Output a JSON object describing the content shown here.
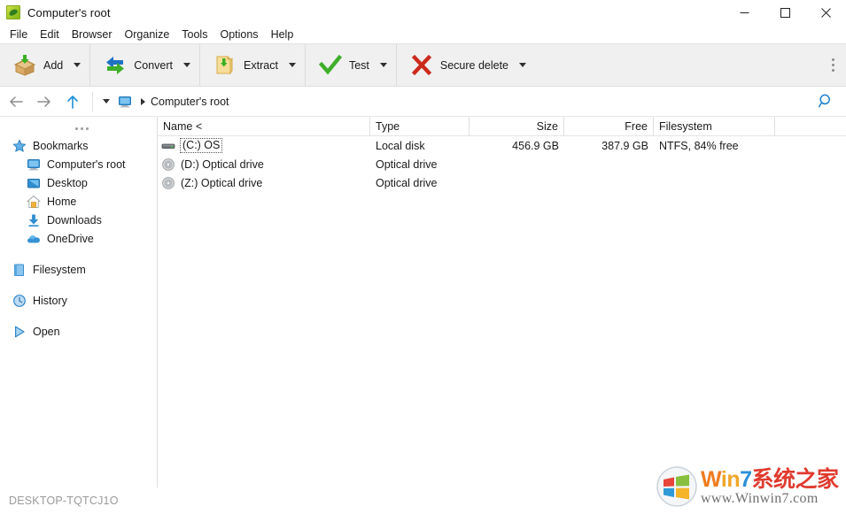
{
  "window": {
    "title": "Computer's root",
    "app_icon": "peazip-icon",
    "controls": {
      "minimize": "minimize-icon",
      "maximize": "maximize-icon",
      "close": "close-icon"
    }
  },
  "menubar": {
    "items": [
      {
        "label": "File"
      },
      {
        "label": "Edit"
      },
      {
        "label": "Browser"
      },
      {
        "label": "Organize"
      },
      {
        "label": "Tools"
      },
      {
        "label": "Options"
      },
      {
        "label": "Help"
      }
    ]
  },
  "toolbar": {
    "buttons": [
      {
        "label": "Add",
        "icon": "add-box-icon",
        "has_dropdown": true
      },
      {
        "label": "Convert",
        "icon": "convert-arrows-icon",
        "has_dropdown": true
      },
      {
        "label": "Extract",
        "icon": "extract-folder-icon",
        "has_dropdown": true
      },
      {
        "label": "Test",
        "icon": "check-mark-icon",
        "has_dropdown": true
      },
      {
        "label": "Secure delete",
        "icon": "red-x-icon",
        "has_dropdown": true
      }
    ],
    "overflow": "toolbar-overflow-icon"
  },
  "addressbar": {
    "back": "back-arrow-icon",
    "forward": "forward-arrow-icon",
    "up": "up-arrow-icon",
    "history_caret": "chevron-down-icon",
    "computer_icon": "computer-monitor-icon",
    "path": "Computer's root",
    "search": "search-icon"
  },
  "sidebar": {
    "overflow": "sidebar-overflow-dots",
    "items": [
      {
        "label": "Bookmarks",
        "icon": "star-icon",
        "indent": false
      },
      {
        "label": "Computer's root",
        "icon": "computer-monitor-icon",
        "indent": true
      },
      {
        "label": "Desktop",
        "icon": "desktop-icon",
        "indent": true
      },
      {
        "label": "Home",
        "icon": "home-icon",
        "indent": true
      },
      {
        "label": "Downloads",
        "icon": "download-arrow-icon",
        "indent": true
      },
      {
        "label": "OneDrive",
        "icon": "cloud-icon",
        "indent": true
      },
      {
        "label": "Filesystem",
        "icon": "filesystem-book-icon",
        "indent": false,
        "gap": true
      },
      {
        "label": "History",
        "icon": "clock-icon",
        "indent": false,
        "gap": true
      },
      {
        "label": "Open",
        "icon": "play-triangle-icon",
        "indent": false,
        "gap": true
      }
    ]
  },
  "filelist": {
    "columns": [
      {
        "key": "name",
        "label": "Name <"
      },
      {
        "key": "type",
        "label": "Type"
      },
      {
        "key": "size",
        "label": "Size"
      },
      {
        "key": "free",
        "label": "Free"
      },
      {
        "key": "filesystem",
        "label": "Filesystem"
      }
    ],
    "sort": {
      "column": "Name",
      "indicator": "<"
    },
    "rows": [
      {
        "name": "(C:) OS",
        "icon": "hard-disk-icon",
        "type": "Local disk",
        "size": "456.9 GB",
        "free": "387.9 GB",
        "filesystem": "NTFS, 84% free",
        "focused": true
      },
      {
        "name": "(D:) Optical drive",
        "icon": "optical-disc-icon",
        "type": "Optical drive",
        "size": "",
        "free": "",
        "filesystem": "",
        "focused": false
      },
      {
        "name": "(Z:) Optical drive",
        "icon": "optical-disc-icon",
        "type": "Optical drive",
        "size": "",
        "free": "",
        "filesystem": "",
        "focused": false
      }
    ]
  },
  "statusbar": {
    "text": "DESKTOP-TQTCJ1O"
  },
  "watermark": {
    "brand_w": "W",
    "brand_i": "in",
    "brand_7": "7",
    "brand_cn": "系统之家",
    "url": "www.Winwin7.com"
  },
  "colors": {
    "toolbar_bg": "#f0f0f0",
    "accent_blue": "#1e8fd6",
    "green": "#3fa72f",
    "red": "#cc2222",
    "status_text": "#9a9a9a"
  }
}
